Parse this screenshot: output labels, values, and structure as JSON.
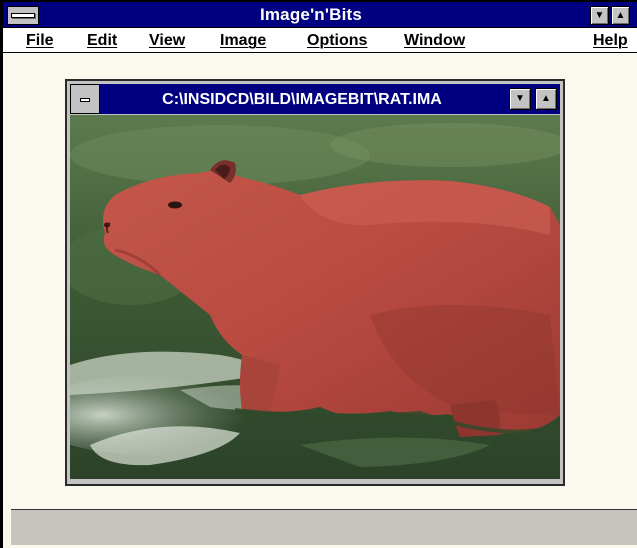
{
  "app": {
    "title": "Image'n'Bits",
    "colors": {
      "title_bar": "#000080",
      "workspace": "#fbf8ee",
      "status_bar": "#c8c5c0"
    }
  },
  "menu": {
    "file": "File",
    "edit": "Edit",
    "view": "View",
    "image": "Image",
    "options": "Options",
    "window": "Window",
    "help": "Help"
  },
  "title_buttons": {
    "minimize": "▼",
    "maximize": "▲"
  },
  "document": {
    "title": "C:\\INSIDCD\\BILD\\IMAGEBIT\\RAT.IMA",
    "buttons": {
      "minimize": "▼",
      "maximize": "▲"
    },
    "image_subject": "capybara-in-water"
  },
  "status": {
    "text": ""
  }
}
